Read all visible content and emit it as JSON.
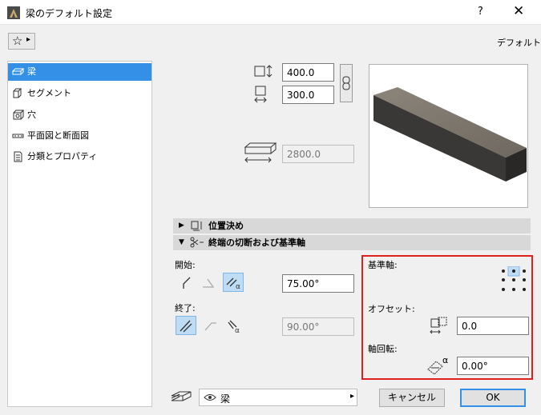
{
  "window": {
    "title": "梁のデフォルト設定",
    "help": "?",
    "close": "✕"
  },
  "favorites": {
    "label": "☆",
    "arrow": "▸"
  },
  "preset": {
    "label": "デフォルト"
  },
  "sidebar": {
    "items": [
      {
        "label": "梁",
        "icon": "beam-icon",
        "selected": true
      },
      {
        "label": "セグメント",
        "icon": "segment-icon",
        "selected": false
      },
      {
        "label": "穴",
        "icon": "hole-icon",
        "selected": false
      },
      {
        "label": "平面図と断面図",
        "icon": "floorplan-section-icon",
        "selected": false
      },
      {
        "label": "分類とプロパティ",
        "icon": "classification-icon",
        "selected": false
      }
    ]
  },
  "geometry": {
    "height": "400.0",
    "width": "300.0",
    "length": "2800.0"
  },
  "sections": {
    "positioning": {
      "label": "位置決め",
      "expanded": false
    },
    "end_cuts": {
      "label": "終端の切断および基準軸",
      "expanded": true
    }
  },
  "end_cuts": {
    "start_label": "開始:",
    "start_angle": "75.00°",
    "end_label": "終了:",
    "end_angle": "90.00°",
    "reference_axis_label": "基準軸:",
    "offset_label": "オフセット:",
    "offset_value": "0.0",
    "axis_rotation_label": "軸回転:",
    "axis_rotation_value": "0.00°",
    "rotation_symbol": "α"
  },
  "footer": {
    "layer": "梁",
    "layer_arrow": "▸",
    "cancel": "キャンセル",
    "ok": "OK"
  },
  "colors": {
    "selection": "#3390e6",
    "highlight_border": "#e01f1f",
    "section_bar": "#d8d8d8"
  }
}
